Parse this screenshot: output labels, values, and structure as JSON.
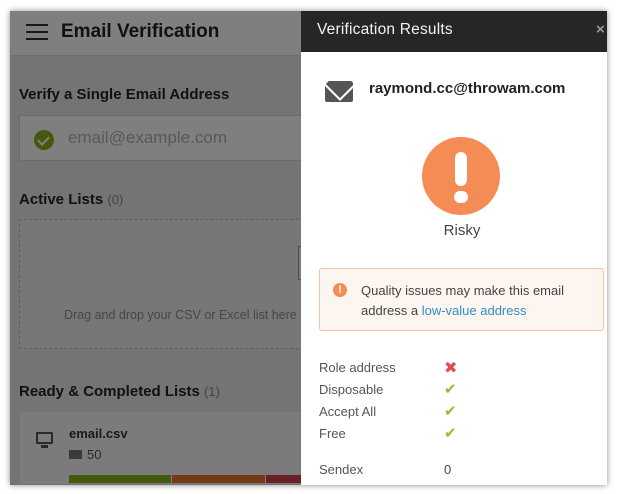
{
  "app": {
    "title": "Email Verification",
    "single_section_title": "Verify a Single Email Address",
    "email_placeholder": "email@example.com",
    "active_lists_title": "Active Lists",
    "active_lists_count": "(0)",
    "dropzone_text": "Drag and drop your CSV or Excel list here",
    "completed_lists_title": "Ready & Completed Lists",
    "completed_lists_count": "(1)",
    "list": {
      "file_name": "email.csv",
      "email_count": "50"
    }
  },
  "panel": {
    "title": "Verification Results",
    "close_glyph": "×",
    "email": "raymond.cc@throwam.com",
    "status": "Risky",
    "status_color": "#f58b55",
    "notice_icon": "!",
    "notice_text": "Quality issues may make this email address a ",
    "notice_link": "low-value address",
    "attributes": [
      {
        "label": "Role address",
        "value": "✖",
        "kind": "x"
      },
      {
        "label": "Disposable",
        "value": "✔",
        "kind": "check"
      },
      {
        "label": "Accept All",
        "value": "✔",
        "kind": "check"
      },
      {
        "label": "Free",
        "value": "✔",
        "kind": "check"
      }
    ],
    "sendex": {
      "label": "Sendex",
      "value": "0"
    }
  },
  "colors": {
    "panel_header": "#262626",
    "accent_green": "#8bb31d",
    "risk_orange": "#f58b55",
    "link_blue": "#2f8fcc",
    "error_red": "#e04e4e"
  }
}
